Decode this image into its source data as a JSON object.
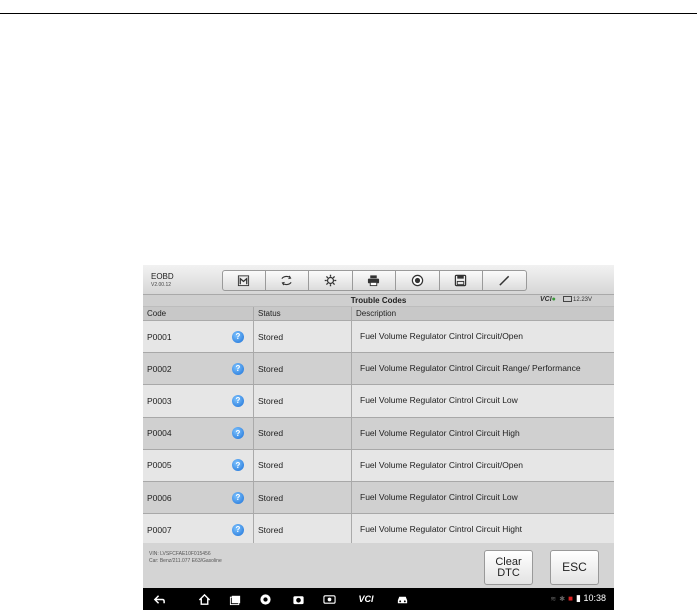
{
  "app": {
    "name": "EOBD",
    "version": "V2.00.12"
  },
  "toolbar": {
    "buttons": [
      {
        "icon": "home-icon"
      },
      {
        "icon": "vehicle-swap-icon"
      },
      {
        "icon": "settings-icon"
      },
      {
        "icon": "print-icon"
      },
      {
        "icon": "help-icon"
      },
      {
        "icon": "save-icon"
      },
      {
        "icon": "edit-icon"
      }
    ]
  },
  "titlebar": {
    "title": "Trouble Codes",
    "vci": "VCI",
    "battery": "12.23V"
  },
  "table": {
    "headers": {
      "code": "Code",
      "status": "Status",
      "description": "Description"
    },
    "rows": [
      {
        "code": "P0001",
        "status": "Stored",
        "description": "Fuel Volume Regulator Cintrol Circuit/Open"
      },
      {
        "code": "P0002",
        "status": "Stored",
        "description": "Fuel Volume Regulator Cintrol Circuit Range/ Performance"
      },
      {
        "code": "P0003",
        "status": "Stored",
        "description": "Fuel Volume Regulator Cintrol Circuit Low"
      },
      {
        "code": "P0004",
        "status": "Stored",
        "description": "Fuel Volume Regulator Cintrol Circuit High"
      },
      {
        "code": "P0005",
        "status": "Stored",
        "description": "Fuel Volume Regulator Cintrol Circuit/Open"
      },
      {
        "code": "P0006",
        "status": "Stored",
        "description": "Fuel Volume Regulator Cintrol Circuit Low"
      },
      {
        "code": "P0007",
        "status": "Stored",
        "description": "Fuel Volume Regulator Cintrol Circuit Hight"
      }
    ],
    "help_glyph": "?"
  },
  "footer": {
    "vin": "VIN: LVSFCFAE10F015456",
    "car": "Car: Benz/211.077 E63/Gasoline",
    "clear_line1": "Clear",
    "clear_line2": "DTC",
    "esc_label": "ESC"
  },
  "navbar": {
    "vcl_label": "VCI",
    "time": "10:38"
  },
  "colors": {
    "help_blue": "#1a6fd6",
    "vci_green": "#3a9a3a"
  }
}
